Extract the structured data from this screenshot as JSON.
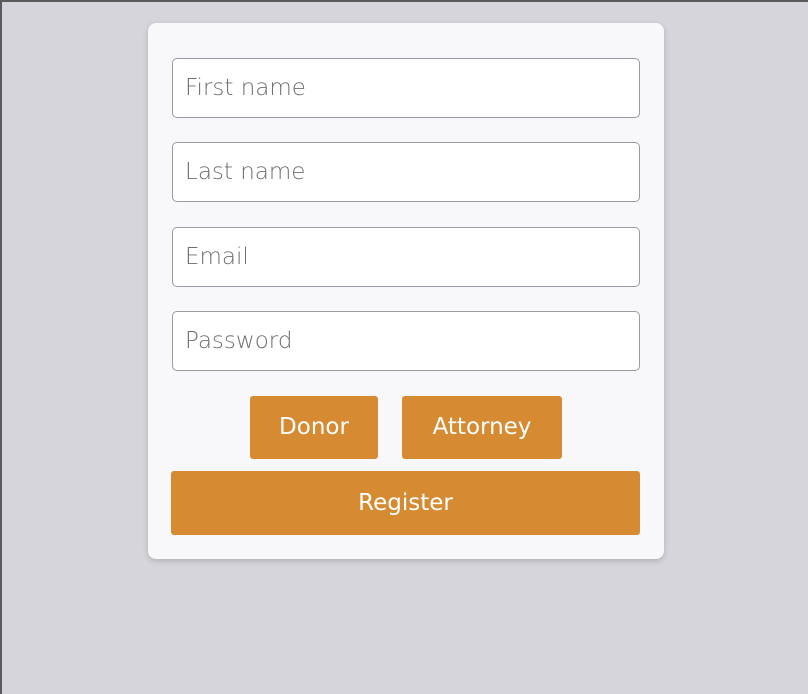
{
  "form": {
    "first_name": {
      "placeholder": "First name",
      "value": ""
    },
    "last_name": {
      "placeholder": "Last name",
      "value": ""
    },
    "email": {
      "placeholder": "Email",
      "value": ""
    },
    "password": {
      "placeholder": "Password",
      "value": ""
    }
  },
  "role_buttons": {
    "donor_label": "Donor",
    "attorney_label": "Attorney"
  },
  "register_label": "Register",
  "colors": {
    "accent": "#d68b32",
    "page_background": "#d6d5db",
    "card_background": "#f8f8fb"
  }
}
